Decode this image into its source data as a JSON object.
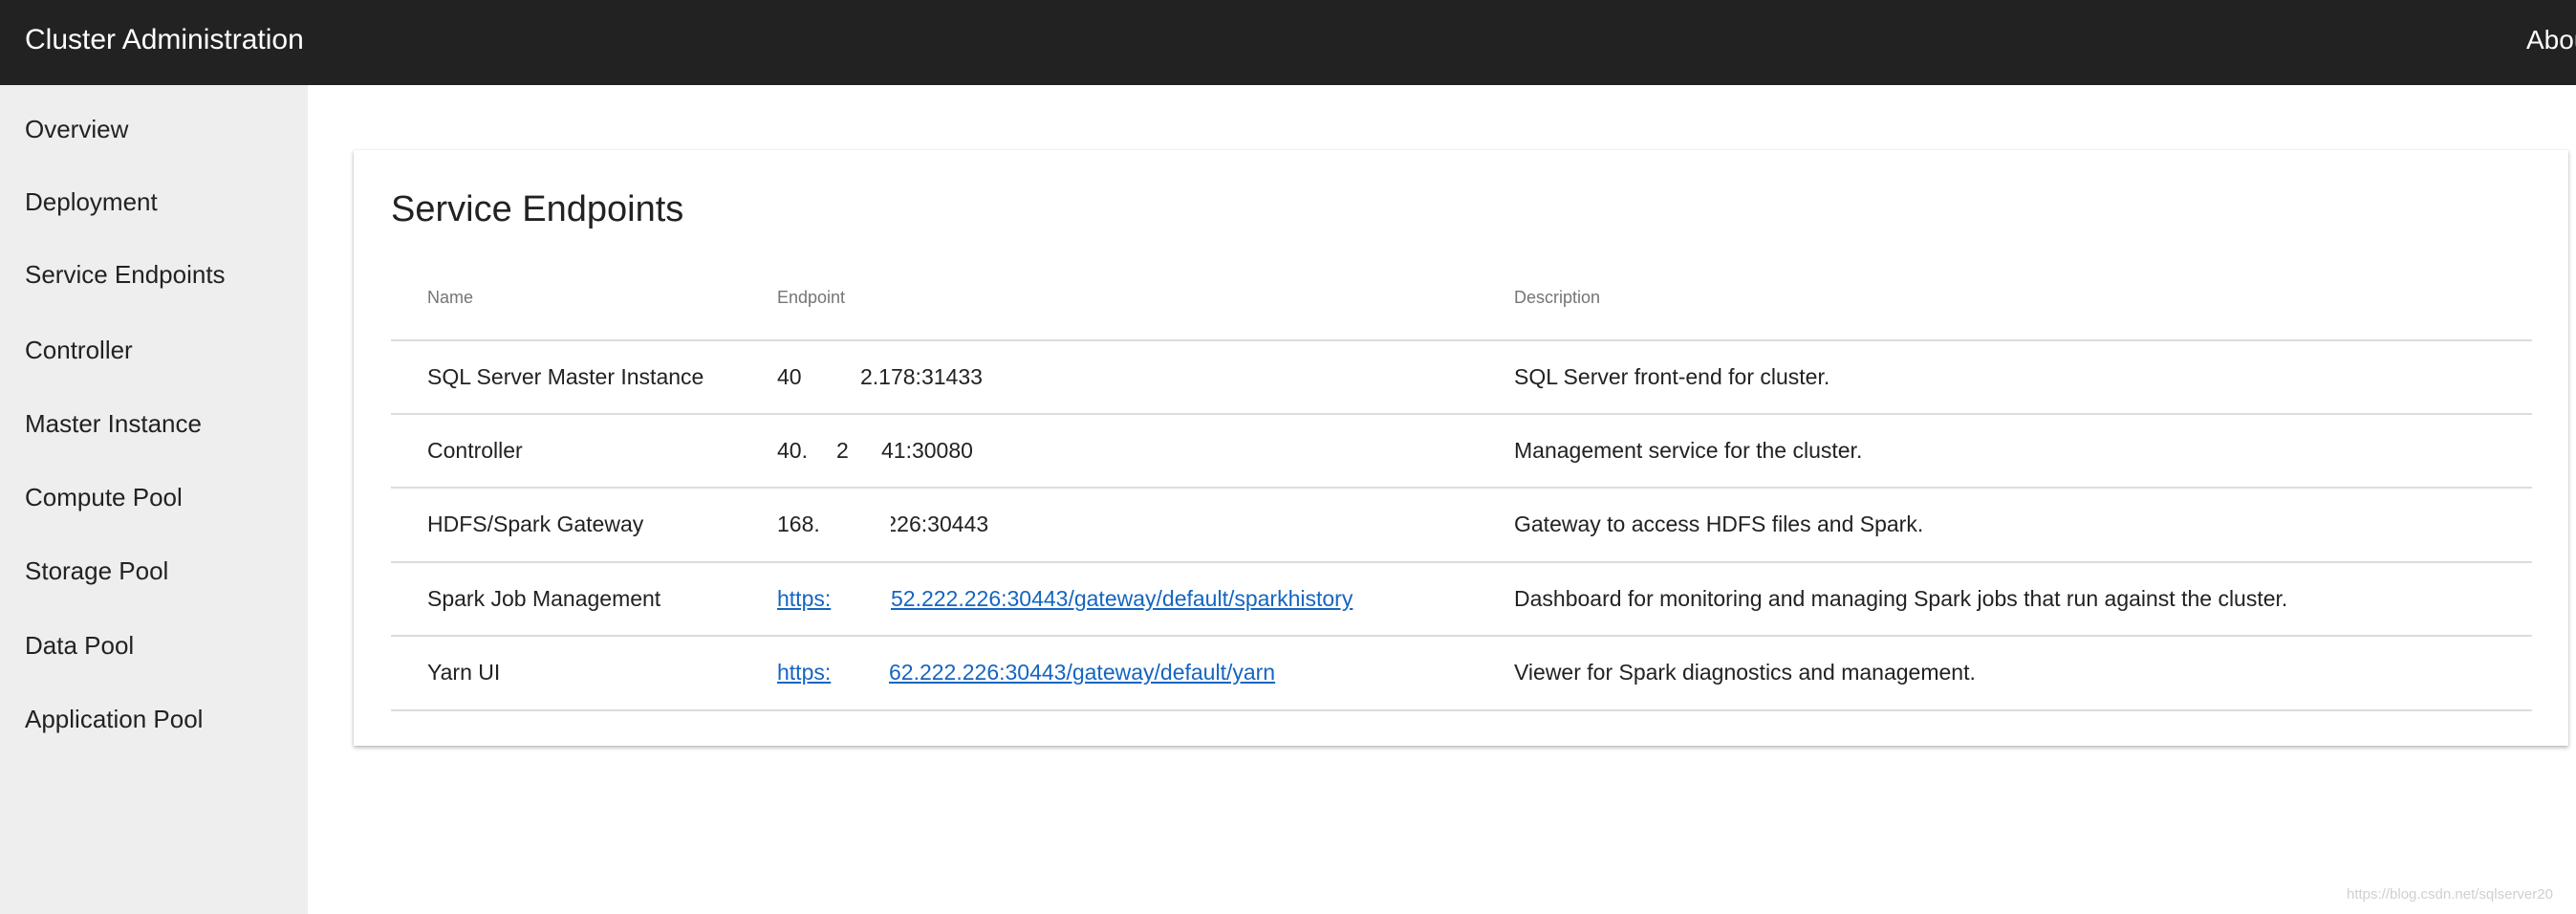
{
  "header": {
    "title": "Cluster Administration",
    "about_label": "Abou"
  },
  "sidebar": {
    "items": [
      {
        "label": "Overview"
      },
      {
        "label": "Deployment"
      },
      {
        "label": "Service Endpoints"
      },
      {
        "label": "Controller"
      },
      {
        "label": "Master Instance"
      },
      {
        "label": "Compute Pool"
      },
      {
        "label": "Storage Pool"
      },
      {
        "label": "Data Pool"
      },
      {
        "label": "Application Pool"
      }
    ]
  },
  "main": {
    "title": "Service Endpoints",
    "columns": [
      "Name",
      "Endpoint",
      "Description"
    ],
    "rows": [
      {
        "name": "SQL Server Master Instance",
        "endpoint_a": "40",
        "endpoint_b": "2.178:31433",
        "description": "SQL Server front-end for cluster."
      },
      {
        "name": "Controller",
        "endpoint_a": "40.",
        "endpoint_b": "2",
        "endpoint_c": "41:30080",
        "description": "Management service for the cluster."
      },
      {
        "name": "HDFS/Spark Gateway",
        "endpoint_a": "168.",
        "endpoint_b": ".226:30443",
        "description": "Gateway to access HDFS files and Spark."
      },
      {
        "name": "Spark Job Management",
        "endpoint_a": "https:",
        "endpoint_b": "52.222.226:30443/gateway/default/sparkhistory",
        "description": "Dashboard for monitoring and managing Spark jobs that run against the cluster."
      },
      {
        "name": "Yarn UI",
        "endpoint_a": "https:",
        "endpoint_b": "62.222.226:30443/gateway/default/yarn",
        "description": "Viewer for Spark diagnostics and management."
      }
    ]
  },
  "watermark": "https://blog.csdn.net/sqlserver20"
}
